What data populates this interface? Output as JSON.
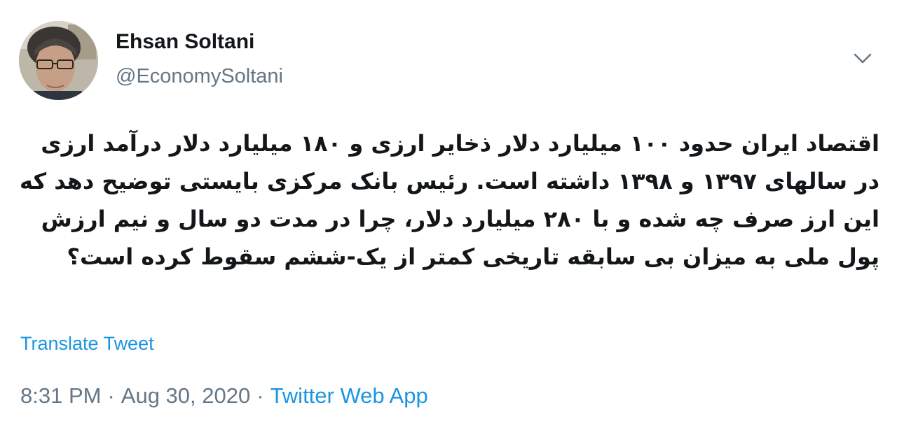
{
  "author": {
    "name": "Ehsan Soltani",
    "handle": "@EconomySoltani",
    "avatar_icon": "profile-photo"
  },
  "tweet": {
    "text": "اقتصاد ایران حدود ۱۰۰ میلیارد دلار ذخایر ارزی و ۱۸۰ میلیارد دلار درآمد ارزی در سالهای ۱۳۹۷ و ۱۳۹۸ داشته است. رئیس بانک مرکزی بایستی توضیح دهد که این ارز صرف چه شده و با ۲۸۰ میلیارد دلار، چرا در مدت دو سال و نیم ارزش پول ملی به میزان بی سابقه تاریخی کمتر از یک-ششم سقوط کرده است؟",
    "translate_label": "Translate Tweet",
    "time": "8:31 PM",
    "separator": "·",
    "date": "Aug 30, 2020",
    "source": "Twitter Web App",
    "menu_icon": "chevron-down-icon"
  },
  "colors": {
    "link": "#1b95e0",
    "secondary": "#657786",
    "text": "#14171a"
  }
}
